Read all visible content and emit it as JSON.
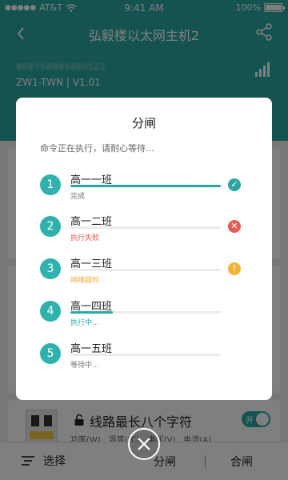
{
  "status_bar": {
    "carrier": "AT&T",
    "time": "9:41 AM",
    "battery": "100%",
    "battery_level": 1.0
  },
  "header": {
    "title": "弘毅楼以太网主机2",
    "device_id": "908758895400522",
    "device_model": "ZW1-TWN  |  V1.01"
  },
  "modal": {
    "title": "分闸",
    "subtitle": "命令正在执行，请耐心等待...",
    "tasks": [
      {
        "num": "1",
        "name": "高一一班",
        "status": "完成",
        "status_color": "#777777",
        "progress": 1.0,
        "icon": "check-icon",
        "icon_glyph": "✓",
        "icon_color": "#2aa7a0"
      },
      {
        "num": "2",
        "name": "高一二班",
        "status": "执行失败",
        "status_color": "#e05a4f",
        "progress": 0.0,
        "icon": "error-icon",
        "icon_glyph": "✕",
        "icon_color": "#e45d52"
      },
      {
        "num": "3",
        "name": "高一三班",
        "status": "网络超时",
        "status_color": "#f0a830",
        "progress": 0.0,
        "icon": "warning-icon",
        "icon_glyph": "!",
        "icon_color": "#f5b23a"
      },
      {
        "num": "4",
        "name": "高一四班",
        "status": "执行中...",
        "status_color": "#2aa7a0",
        "progress": 0.28,
        "icon": "",
        "icon_glyph": "",
        "icon_color": ""
      },
      {
        "num": "5",
        "name": "高一五班",
        "status": "等待中...",
        "status_color": "#777777",
        "progress": 0.0,
        "icon": "",
        "icon_glyph": "",
        "icon_color": ""
      }
    ]
  },
  "breaker": {
    "name": "线路最长八个字符",
    "toggle_label": "开",
    "metrics": [
      "功率(W)",
      "温度(℃)",
      "电压(V)",
      "电流(A)"
    ]
  },
  "bottom_bar": {
    "select_label": "选择",
    "open_label": "分闸",
    "close_label": "合闸"
  },
  "colors": {
    "accent": "#2aa7a0",
    "error": "#e45d52",
    "warning": "#f5b23a"
  }
}
